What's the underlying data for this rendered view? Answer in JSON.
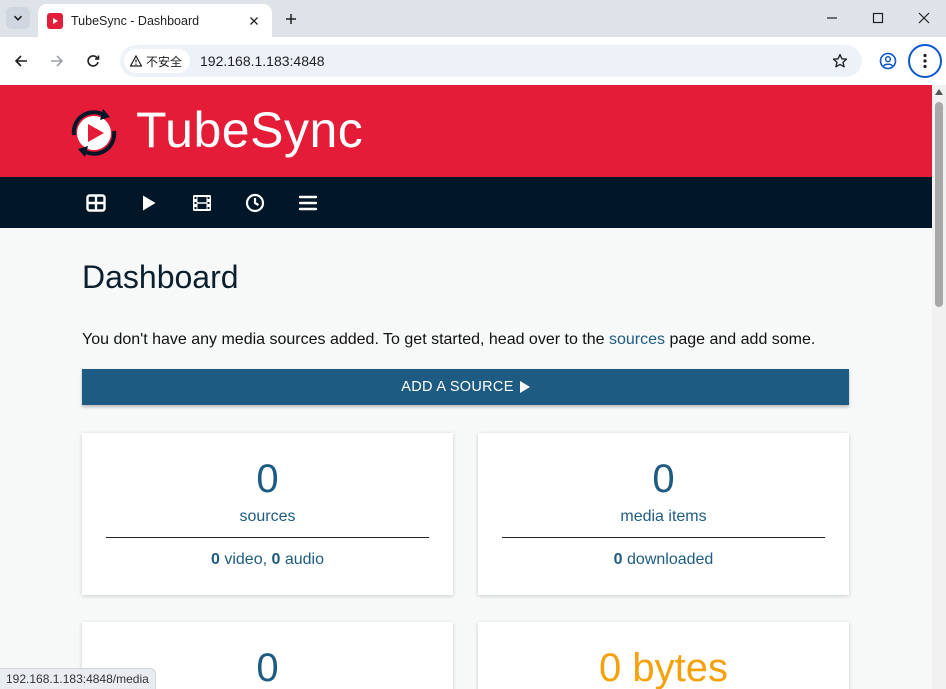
{
  "browser": {
    "tab_title": "TubeSync - Dashboard",
    "security_label": "不安全",
    "url": "192.168.1.183:4848",
    "status_url": "192.168.1.183:4848/media"
  },
  "site": {
    "brand": "TubeSync",
    "brand_color": "#e51c38",
    "nav_bg": "#011627",
    "nav": [
      {
        "icon": "grid-icon"
      },
      {
        "icon": "play-icon"
      },
      {
        "icon": "film-icon"
      },
      {
        "icon": "clock-icon"
      },
      {
        "icon": "list-icon"
      }
    ]
  },
  "main": {
    "title": "Dashboard",
    "intro_before": "You don't have any media sources added. To get started, head over to the ",
    "intro_link": "sources",
    "intro_after": " page and add some.",
    "add_source_label": "ADD A SOURCE",
    "accent": "#1e5b82",
    "cards": [
      {
        "number": "0",
        "label": "sources",
        "detail": {
          "video_count": "0",
          "video_label": " video, ",
          "audio_count": "0",
          "audio_label": " audio"
        }
      },
      {
        "number": "0",
        "label": "media items",
        "detail": {
          "count": "0",
          "label": " downloaded"
        }
      },
      {
        "number": "0"
      },
      {
        "number": "0 bytes",
        "color": "#f5a10c"
      }
    ]
  }
}
